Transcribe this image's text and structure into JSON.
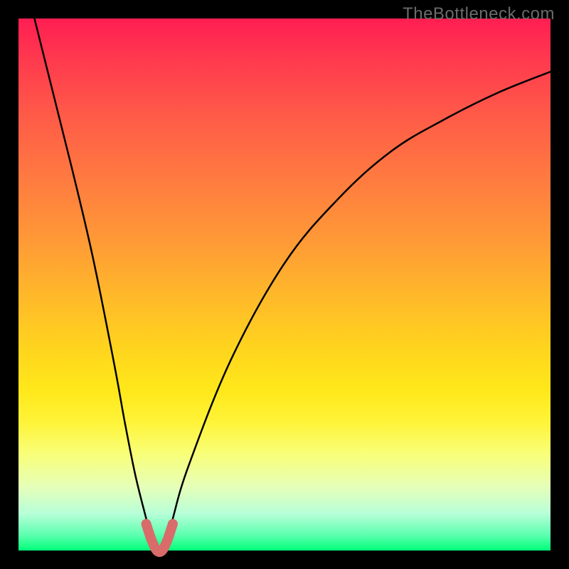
{
  "watermark": "TheBottleneck.com",
  "chart_data": {
    "type": "line",
    "title": "",
    "xlabel": "",
    "ylabel": "",
    "xlim": [
      0,
      100
    ],
    "ylim": [
      0,
      100
    ],
    "series": [
      {
        "name": "curve",
        "x": [
          3,
          6,
          10,
          14,
          18,
          20,
          22,
          24,
          25,
          26,
          27,
          28,
          29,
          32,
          40,
          50,
          60,
          70,
          80,
          90,
          100
        ],
        "y": [
          100,
          88,
          72,
          55,
          35,
          24,
          14,
          6,
          2,
          0,
          0,
          2,
          6,
          16,
          36,
          54,
          66,
          75,
          81,
          86,
          90
        ]
      },
      {
        "name": "highlight",
        "x": [
          24,
          25,
          26,
          27,
          28,
          29
        ],
        "y": [
          5,
          2,
          0,
          0,
          2,
          5
        ]
      }
    ],
    "gradient_stops": [
      {
        "pos": 0,
        "color": "#ff1e52"
      },
      {
        "pos": 50,
        "color": "#ffc020"
      },
      {
        "pos": 80,
        "color": "#ffff60"
      },
      {
        "pos": 100,
        "color": "#00ff7a"
      }
    ]
  }
}
